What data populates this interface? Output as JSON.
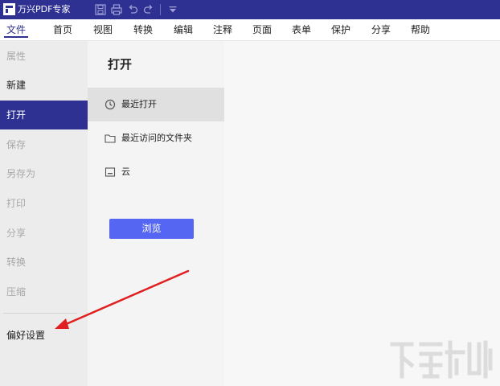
{
  "titlebar": {
    "app_title": "万兴PDF专家",
    "toolbar_icons": [
      "save-icon",
      "print-icon",
      "undo-icon",
      "redo-icon",
      "customize-dropdown-icon"
    ]
  },
  "menu": {
    "items": [
      {
        "label": "文件",
        "active": true
      },
      {
        "label": "首页"
      },
      {
        "label": "视图"
      },
      {
        "label": "转换"
      },
      {
        "label": "编辑"
      },
      {
        "label": "注释"
      },
      {
        "label": "页面"
      },
      {
        "label": "表单"
      },
      {
        "label": "保护"
      },
      {
        "label": "分享"
      },
      {
        "label": "帮助"
      }
    ]
  },
  "sidebar": {
    "items": [
      {
        "label": "属性",
        "state": "disabled"
      },
      {
        "label": "新建",
        "state": "enabled"
      },
      {
        "label": "打开",
        "state": "active"
      },
      {
        "label": "保存",
        "state": "disabled"
      },
      {
        "label": "另存为",
        "state": "disabled"
      },
      {
        "label": "打印",
        "state": "disabled"
      },
      {
        "label": "分享",
        "state": "disabled"
      },
      {
        "label": "转换",
        "state": "disabled"
      },
      {
        "label": "压缩",
        "state": "disabled"
      },
      {
        "label": "偏好设置",
        "state": "enabled"
      }
    ]
  },
  "open_panel": {
    "title": "打开",
    "locations": [
      {
        "label": "最近打开",
        "icon": "clock-icon",
        "selected": true
      },
      {
        "label": "最近访问的文件夹",
        "icon": "folder-icon"
      },
      {
        "label": "云",
        "icon": "cloud-drive-icon"
      }
    ],
    "browse_label": "浏览"
  },
  "colors": {
    "brand": "#2e3192",
    "button": "#5566f2",
    "annotation_arrow": "#e02020"
  }
}
